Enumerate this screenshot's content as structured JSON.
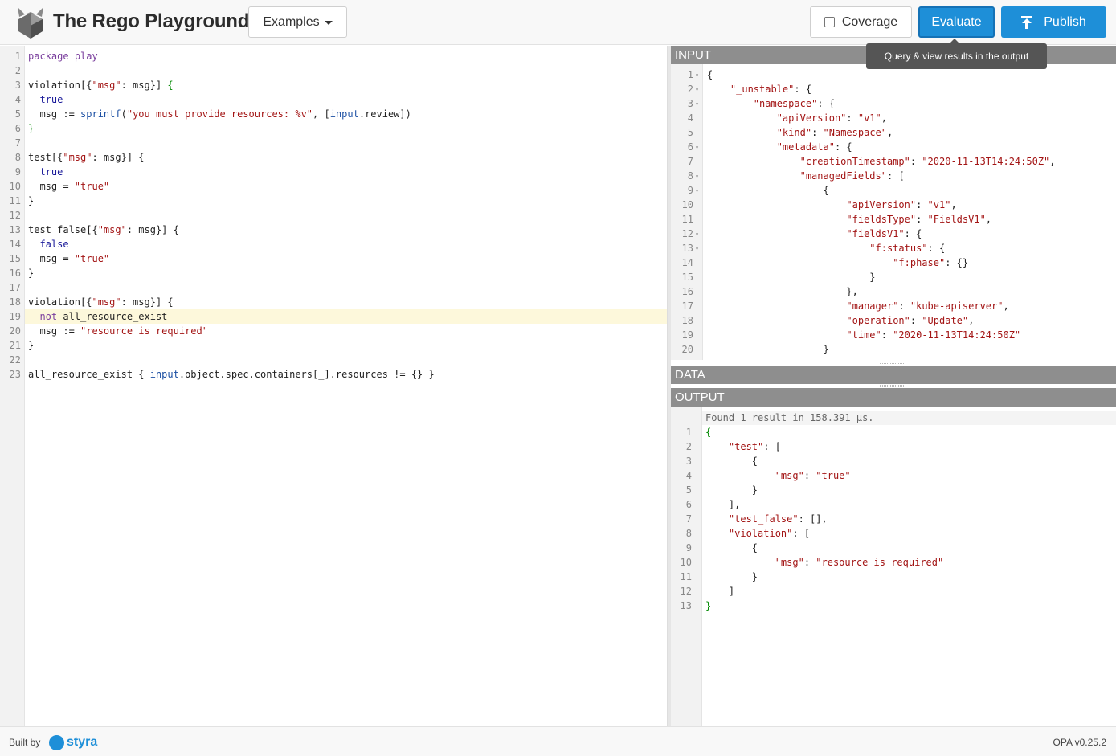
{
  "header": {
    "title": "The Rego Playground",
    "examples_label": "Examples",
    "coverage_label": "Coverage",
    "coverage_checked": false,
    "evaluate_label": "Evaluate",
    "publish_label": "Publish",
    "evaluate_tooltip": "Query & view results in the output"
  },
  "colors": {
    "accent": "#1e8fd8",
    "pane_header": "#8e8e8e"
  },
  "editor": {
    "active_line": 19,
    "lines": [
      [
        [
          "k",
          "package"
        ],
        [
          "t",
          " "
        ],
        [
          "k",
          "play"
        ]
      ],
      [],
      [
        [
          "t",
          "violation[{"
        ],
        [
          "s",
          "\"msg\""
        ],
        [
          "t",
          ": msg}] "
        ],
        [
          "g",
          "{"
        ]
      ],
      [
        [
          "t",
          "  "
        ],
        [
          "kw",
          "true"
        ]
      ],
      [
        [
          "t",
          "  msg := "
        ],
        [
          "b",
          "sprintf"
        ],
        [
          "t",
          "("
        ],
        [
          "s",
          "\"you must provide resources: %v\""
        ],
        [
          "t",
          ", ["
        ],
        [
          "b",
          "input"
        ],
        [
          "t",
          ".review])"
        ]
      ],
      [
        [
          "g",
          "}"
        ]
      ],
      [],
      [
        [
          "t",
          "test[{"
        ],
        [
          "s",
          "\"msg\""
        ],
        [
          "t",
          ": msg}] {"
        ]
      ],
      [
        [
          "t",
          "  "
        ],
        [
          "kw",
          "true"
        ]
      ],
      [
        [
          "t",
          "  msg = "
        ],
        [
          "s",
          "\"true\""
        ]
      ],
      [
        [
          "t",
          "}"
        ]
      ],
      [],
      [
        [
          "t",
          "test_false[{"
        ],
        [
          "s",
          "\"msg\""
        ],
        [
          "t",
          ": msg}] {"
        ]
      ],
      [
        [
          "t",
          "  "
        ],
        [
          "kw",
          "false"
        ]
      ],
      [
        [
          "t",
          "  msg = "
        ],
        [
          "s",
          "\"true\""
        ]
      ],
      [
        [
          "t",
          "}"
        ]
      ],
      [],
      [
        [
          "t",
          "violation[{"
        ],
        [
          "s",
          "\"msg\""
        ],
        [
          "t",
          ": msg}] {"
        ]
      ],
      [
        [
          "t",
          "  "
        ],
        [
          "k",
          "not"
        ],
        [
          "t",
          " all_resource_exist"
        ]
      ],
      [
        [
          "t",
          "  msg := "
        ],
        [
          "s",
          "\"resource is required\""
        ]
      ],
      [
        [
          "t",
          "}"
        ]
      ],
      [],
      [
        [
          "t",
          "all_resource_exist { "
        ],
        [
          "b",
          "input"
        ],
        [
          "t",
          ".object.spec.containers[_].resources != {} }"
        ]
      ]
    ]
  },
  "panes": {
    "input_label": "INPUT",
    "data_label": "DATA",
    "output_label": "OUTPUT"
  },
  "input": {
    "fold_lines": [
      1,
      2,
      3,
      6,
      8,
      9,
      12,
      13
    ],
    "lines": [
      [
        [
          "t",
          "{"
        ]
      ],
      [
        [
          "t",
          "    "
        ],
        [
          "jk",
          "\"_unstable\""
        ],
        [
          "t",
          ": {"
        ]
      ],
      [
        [
          "t",
          "        "
        ],
        [
          "jk",
          "\"namespace\""
        ],
        [
          "t",
          ": {"
        ]
      ],
      [
        [
          "t",
          "            "
        ],
        [
          "jk",
          "\"apiVersion\""
        ],
        [
          "t",
          ": "
        ],
        [
          "js",
          "\"v1\""
        ],
        [
          "t",
          ","
        ]
      ],
      [
        [
          "t",
          "            "
        ],
        [
          "jk",
          "\"kind\""
        ],
        [
          "t",
          ": "
        ],
        [
          "js",
          "\"Namespace\""
        ],
        [
          "t",
          ","
        ]
      ],
      [
        [
          "t",
          "            "
        ],
        [
          "jk",
          "\"metadata\""
        ],
        [
          "t",
          ": {"
        ]
      ],
      [
        [
          "t",
          "                "
        ],
        [
          "jk",
          "\"creationTimestamp\""
        ],
        [
          "t",
          ": "
        ],
        [
          "js",
          "\"2020-11-13T14:24:50Z\""
        ],
        [
          "t",
          ","
        ]
      ],
      [
        [
          "t",
          "                "
        ],
        [
          "jk",
          "\"managedFields\""
        ],
        [
          "t",
          ": ["
        ]
      ],
      [
        [
          "t",
          "                    {"
        ]
      ],
      [
        [
          "t",
          "                        "
        ],
        [
          "jk",
          "\"apiVersion\""
        ],
        [
          "t",
          ": "
        ],
        [
          "js",
          "\"v1\""
        ],
        [
          "t",
          ","
        ]
      ],
      [
        [
          "t",
          "                        "
        ],
        [
          "jk",
          "\"fieldsType\""
        ],
        [
          "t",
          ": "
        ],
        [
          "js",
          "\"FieldsV1\""
        ],
        [
          "t",
          ","
        ]
      ],
      [
        [
          "t",
          "                        "
        ],
        [
          "jk",
          "\"fieldsV1\""
        ],
        [
          "t",
          ": {"
        ]
      ],
      [
        [
          "t",
          "                            "
        ],
        [
          "jk",
          "\"f:status\""
        ],
        [
          "t",
          ": {"
        ]
      ],
      [
        [
          "t",
          "                                "
        ],
        [
          "jk",
          "\"f:phase\""
        ],
        [
          "t",
          ": {}"
        ]
      ],
      [
        [
          "t",
          "                            }"
        ]
      ],
      [
        [
          "t",
          "                        },"
        ]
      ],
      [
        [
          "t",
          "                        "
        ],
        [
          "jk",
          "\"manager\""
        ],
        [
          "t",
          ": "
        ],
        [
          "js",
          "\"kube-apiserver\""
        ],
        [
          "t",
          ","
        ]
      ],
      [
        [
          "t",
          "                        "
        ],
        [
          "jk",
          "\"operation\""
        ],
        [
          "t",
          ": "
        ],
        [
          "js",
          "\"Update\""
        ],
        [
          "t",
          ","
        ]
      ],
      [
        [
          "t",
          "                        "
        ],
        [
          "jk",
          "\"time\""
        ],
        [
          "t",
          ": "
        ],
        [
          "js",
          "\"2020-11-13T14:24:50Z\""
        ]
      ],
      [
        [
          "t",
          "                    }"
        ]
      ]
    ]
  },
  "output": {
    "result_text": "Found 1 result in 158.391 µs.",
    "lines": [
      [
        [
          "g",
          "{"
        ]
      ],
      [
        [
          "t",
          "    "
        ],
        [
          "jk",
          "\"test\""
        ],
        [
          "t",
          ": ["
        ]
      ],
      [
        [
          "t",
          "        {"
        ]
      ],
      [
        [
          "t",
          "            "
        ],
        [
          "jk",
          "\"msg\""
        ],
        [
          "t",
          ": "
        ],
        [
          "js",
          "\"true\""
        ]
      ],
      [
        [
          "t",
          "        }"
        ]
      ],
      [
        [
          "t",
          "    ],"
        ]
      ],
      [
        [
          "t",
          "    "
        ],
        [
          "jk",
          "\"test_false\""
        ],
        [
          "t",
          ": [],"
        ]
      ],
      [
        [
          "t",
          "    "
        ],
        [
          "jk",
          "\"violation\""
        ],
        [
          "t",
          ": ["
        ]
      ],
      [
        [
          "t",
          "        {"
        ]
      ],
      [
        [
          "t",
          "            "
        ],
        [
          "jk",
          "\"msg\""
        ],
        [
          "t",
          ": "
        ],
        [
          "js",
          "\"resource is required\""
        ]
      ],
      [
        [
          "t",
          "        }"
        ]
      ],
      [
        [
          "t",
          "    ]"
        ]
      ],
      [
        [
          "g",
          "}"
        ]
      ]
    ]
  },
  "footer": {
    "built_by": "Built by",
    "brand": "styra",
    "version": "OPA v0.25.2"
  }
}
